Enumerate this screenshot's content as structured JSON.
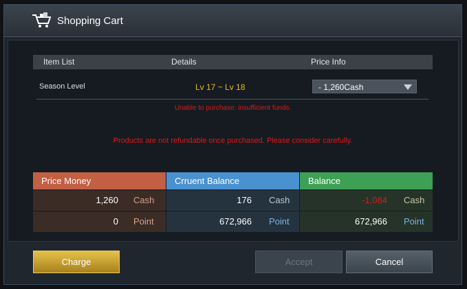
{
  "window": {
    "title": "Shopping Cart",
    "icon": "shopping-cart-icon"
  },
  "table": {
    "headers": {
      "item": "Item List",
      "details": "Details",
      "price": "Price Info"
    },
    "row": {
      "item": "Season Level",
      "details": "Lv 17 ~ Lv 18",
      "price_selected": "- 1,260Cash"
    }
  },
  "messages": {
    "insufficient": "Unable to purchase: insufficient funds.",
    "refund_warning": "Products are not refundable once purchased. Please consider carefully."
  },
  "balance": {
    "price_money": {
      "label": "Price Money",
      "cash": "1,260",
      "cash_unit": "Cash",
      "point": "0",
      "point_unit": "Point",
      "color": "#c35f43"
    },
    "current": {
      "label": "Crruent Balance",
      "cash": "176",
      "cash_unit": "Cash",
      "point": "672,966",
      "point_unit": "Point",
      "color": "#4a91cf"
    },
    "remaining": {
      "label": "Balance",
      "cash": "-1,084",
      "cash_unit": "Cash",
      "point": "672,966",
      "point_unit": "Point",
      "color": "#3ea055"
    }
  },
  "buttons": {
    "charge": "Charge",
    "accept": "Accept",
    "cancel": "Cancel"
  }
}
